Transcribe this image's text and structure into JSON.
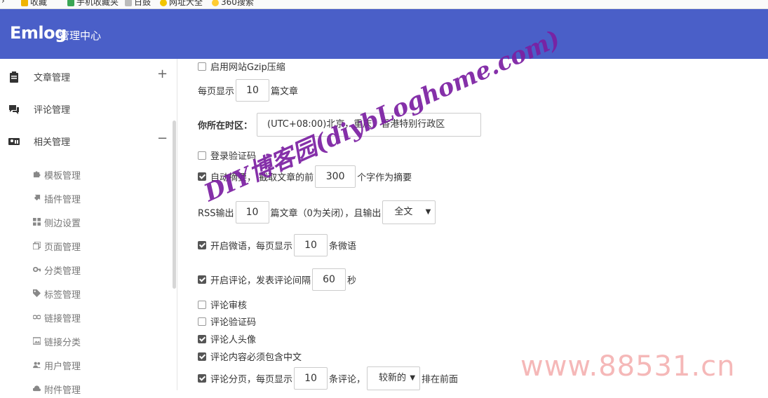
{
  "bookmarks": [
    "收藏",
    "手机收藏夹",
    "日鼓",
    "网址大全",
    "360搜索"
  ],
  "header": {
    "logo": "Emlog",
    "subtitle": "管理中心"
  },
  "sidebar": {
    "items": [
      {
        "label": "文章管理",
        "toggle": "+"
      },
      {
        "label": "评论管理",
        "toggle": ""
      },
      {
        "label": "相关管理",
        "toggle": "−"
      }
    ],
    "subitems": [
      {
        "label": "模板管理"
      },
      {
        "label": "插件管理"
      },
      {
        "label": "侧边设置"
      },
      {
        "label": "页面管理"
      },
      {
        "label": "分类管理"
      },
      {
        "label": "标签管理"
      },
      {
        "label": "链接管理"
      },
      {
        "label": "链接分类"
      },
      {
        "label": "用户管理"
      },
      {
        "label": "附件管理"
      }
    ]
  },
  "settings": {
    "gzip": {
      "label": "启用网站Gzip压缩",
      "checked": false
    },
    "per_page": {
      "prefix": "每页显示",
      "value": "10",
      "suffix": "篇文章"
    },
    "timezone": {
      "label": "你所在时区：",
      "value": "(UTC+08:00)北京，重庆，香港特别行政区"
    },
    "login_captcha": {
      "label": "登录验证码",
      "checked": false
    },
    "auto_summary": {
      "label": "自动摘要， 截取文章的前",
      "value": "300",
      "suffix": "个字作为摘要",
      "checked": true
    },
    "rss": {
      "prefix": "RSS输出",
      "value": "10",
      "middle": "篇文章（0为关闭），且输出",
      "select": "全文"
    },
    "twitter": {
      "label": "开启微语，每页显示",
      "value": "10",
      "suffix": "条微语",
      "checked": true
    },
    "comments": {
      "label": "开启评论，发表评论间隔",
      "value": "60",
      "suffix": "秒",
      "checked": true
    },
    "comment_review": {
      "label": "评论审核",
      "checked": false
    },
    "comment_captcha": {
      "label": "评论验证码",
      "checked": false
    },
    "comment_avatar": {
      "label": "评论人头像",
      "checked": true
    },
    "comment_chinese": {
      "label": "评论内容必须包含中文",
      "checked": true
    },
    "comment_paging": {
      "label": "评论分页，每页显示",
      "value": "10",
      "middle": "条评论，",
      "select": "较新的",
      "suffix": "排在前面",
      "checked": true
    }
  },
  "watermarks": {
    "primary": "DIY博客园(diybLoghome.com)",
    "secondary": "www.88531.cn"
  }
}
